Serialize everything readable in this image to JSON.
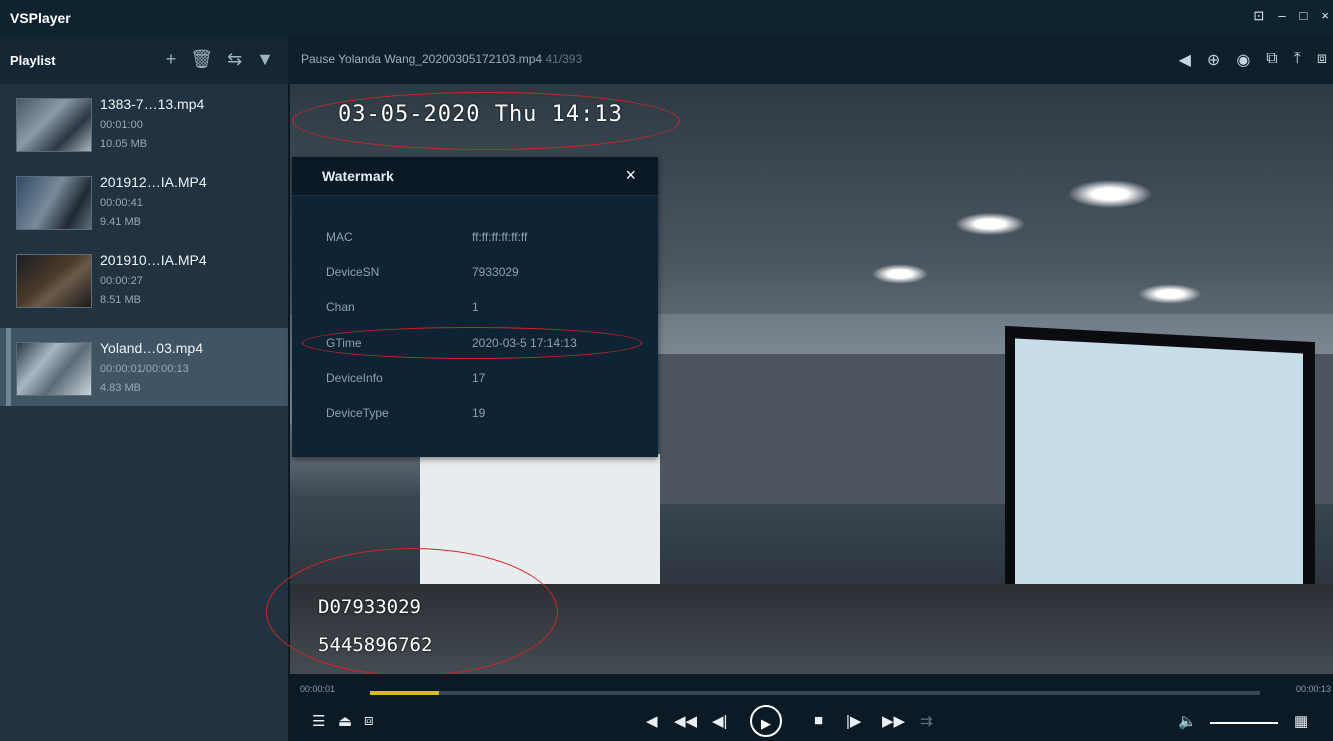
{
  "app": {
    "title": "VSPlayer",
    "window_controls": [
      "⊡",
      "–",
      "□",
      "×"
    ]
  },
  "playlist": {
    "title": "Playlist",
    "tools": [
      "+",
      "🗑",
      "⇆",
      "▼"
    ],
    "items": [
      {
        "name": "1383-7…13.mp4",
        "duration": "00:01:00",
        "size": "10.05 MB",
        "active": false
      },
      {
        "name": "201912…IA.MP4",
        "duration": "00:00:41",
        "size": "9.41 MB",
        "active": false
      },
      {
        "name": "201910…IA.MP4",
        "duration": "00:00:27",
        "size": "8.51 MB",
        "active": false
      },
      {
        "name": "Yoland…03.mp4",
        "duration": "00:00:01/00:00:13",
        "size": "4.83 MB",
        "active": true
      }
    ]
  },
  "player": {
    "status_text": "Pause Yolanda Wang_20200305172103.mp4",
    "frame_count": "41/393",
    "toolbar_icons": [
      "◀",
      "⊕",
      "◉",
      "⧉",
      "⤒",
      "⧈"
    ]
  },
  "video_overlay": {
    "timestamp": "03-05-2020 Thu   14:13",
    "device_id": "D07933029",
    "serial": "5445896762"
  },
  "watermark": {
    "title": "Watermark",
    "close": "×",
    "rows": [
      {
        "key": "MAC",
        "value": "ff:ff:ff:ff:ff:ff"
      },
      {
        "key": "DeviceSN",
        "value": "7933029"
      },
      {
        "key": "Chan",
        "value": "1"
      },
      {
        "key": "GTime",
        "value": "2020-03-5  17:14:13"
      },
      {
        "key": "DeviceInfo",
        "value": "17"
      },
      {
        "key": "DeviceType",
        "value": "19"
      }
    ]
  },
  "progress": {
    "current": "00:00:01",
    "total": "00:00:13",
    "played_fraction": 0.077
  },
  "controls": {
    "left": [
      "☰",
      "⏏",
      "⧈"
    ],
    "center": [
      "◀",
      "◀◀",
      "◀|",
      "▶",
      "■",
      "|▶",
      "▶▶",
      "⇉"
    ],
    "volume_icon": "🔈",
    "grid_icon": "▦"
  }
}
